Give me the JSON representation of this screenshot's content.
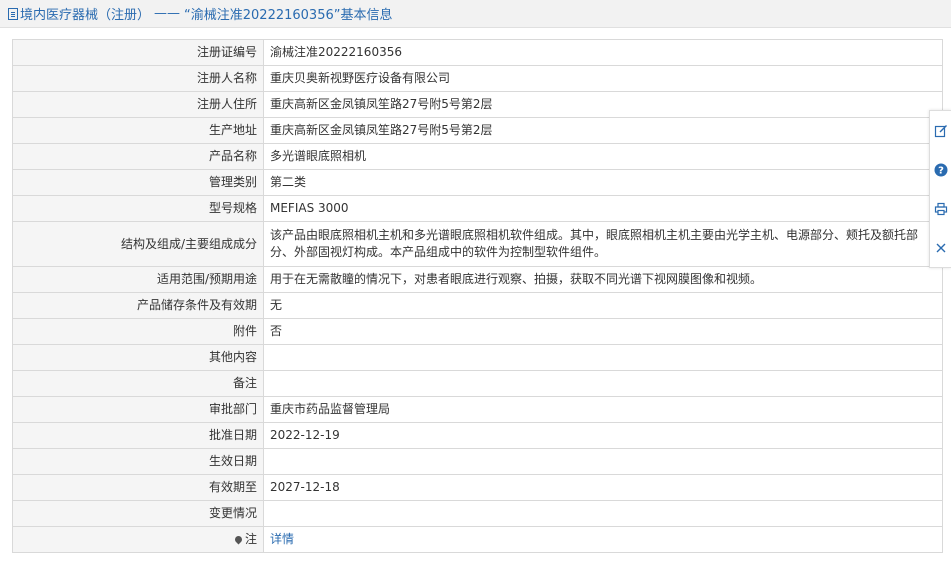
{
  "header": {
    "category": "境内医疗器械（注册）",
    "separator": "——",
    "record_title": "“渝械注准20222160356”基本信息"
  },
  "rows": [
    {
      "label": "注册证编号",
      "value": "渝械注准20222160356"
    },
    {
      "label": "注册人名称",
      "value": "重庆贝奥新视野医疗设备有限公司"
    },
    {
      "label": "注册人住所",
      "value": "重庆高新区金凤镇凤笙路27号附5号第2层"
    },
    {
      "label": "生产地址",
      "value": "重庆高新区金凤镇凤笙路27号附5号第2层"
    },
    {
      "label": "产品名称",
      "value": "多光谱眼底照相机"
    },
    {
      "label": "管理类别",
      "value": "第二类"
    },
    {
      "label": "型号规格",
      "value": "MEFIAS 3000"
    },
    {
      "label": "结构及组成/主要组成成分",
      "value": "该产品由眼底照相机主机和多光谱眼底照相机软件组成。其中，眼底照相机主机主要由光学主机、电源部分、颊托及额托部分、外部固视灯构成。本产品组成中的软件为控制型软件组件。"
    },
    {
      "label": "适用范围/预期用途",
      "value": "用于在无需散瞳的情况下，对患者眼底进行观察、拍摄，获取不同光谱下视网膜图像和视频。"
    },
    {
      "label": "产品储存条件及有效期",
      "value": "无"
    },
    {
      "label": "附件",
      "value": "否"
    },
    {
      "label": "其他内容",
      "value": ""
    },
    {
      "label": "备注",
      "value": ""
    },
    {
      "label": "审批部门",
      "value": "重庆市药品监督管理局"
    },
    {
      "label": "批准日期",
      "value": "2022-12-19"
    },
    {
      "label": "生效日期",
      "value": ""
    },
    {
      "label": "有效期至",
      "value": "2027-12-18"
    },
    {
      "label": "变更情况",
      "value": ""
    }
  ],
  "note": {
    "label": "注",
    "link_text": "详情",
    "icon": "pin-icon"
  },
  "side_tools": [
    "edit-icon",
    "help-icon",
    "print-icon",
    "close-icon"
  ],
  "colors": {
    "accent": "#2a6bb0",
    "label_bg": "#f5f5f5",
    "border": "#d9d9d9",
    "header_bg": "#f2f2f2"
  }
}
